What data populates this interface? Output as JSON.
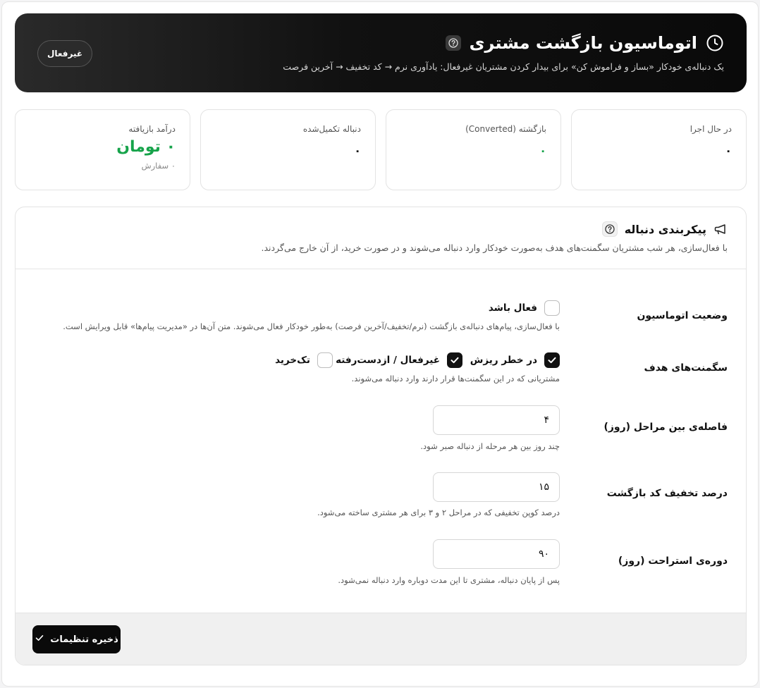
{
  "header": {
    "title": "اتوماسیون بازگشت مشتری",
    "subtitle": "یک دنباله‌ی خودکار «بساز و فراموش کن» برای بیدار کردن مشتریان غیرفعال: یادآوری نرم → کد تخفیف → آخرین فرصت",
    "status_button": "غیرفعال",
    "icon": "clock-icon",
    "help_icon": "help-icon"
  },
  "stats": [
    {
      "label": "در حال اجرا",
      "value": "۰"
    },
    {
      "label": "بازگشته (Converted)",
      "value": "۰",
      "color": "#16a34a"
    },
    {
      "label": "دنباله تکمیل‌شده",
      "value": "۰"
    },
    {
      "label": "درآمد بازیافته",
      "value": "۰ تومان",
      "sub": "۰ سفارش",
      "color": "#16a34a"
    }
  ],
  "config": {
    "title": "پیکربندی دنباله",
    "description": "با فعال‌سازی، هر شب مشتریان سگمنت‌های هدف به‌صورت خودکار وارد دنباله می‌شوند و در صورت خرید، از آن خارج می‌گردند.",
    "status": {
      "label": "وضعیت اتوماسیون",
      "checkbox_label": "فعال باشد",
      "checked": false,
      "helper": "با فعال‌سازی، پیام‌های دنباله‌ی بازگشت (نرم/تخفیف/آخرین فرصت) به‌طور خودکار فعال می‌شوند. متن آن‌ها در «مدیریت پیام‌ها» قابل ویرایش است."
    },
    "segments": {
      "label": "سگمنت‌های هدف",
      "options": [
        {
          "label": "در خطر ریزش",
          "checked": true
        },
        {
          "label": "غیرفعال / ازدست‌رفته",
          "checked": true
        },
        {
          "label": "تک‌خرید",
          "checked": false
        }
      ],
      "helper": "مشتریانی که در این سگمنت‌ها قرار دارند وارد دنباله می‌شوند."
    },
    "interval": {
      "label": "فاصله‌ی بین مراحل (روز)",
      "value": "۴",
      "helper": "چند روز بین هر مرحله از دنباله صبر شود."
    },
    "discount": {
      "label": "درصد تخفیف کد بازگشت",
      "value": "۱۵",
      "helper": "درصد کوپن تخفیفی که در مراحل ۲ و ۳ برای هر مشتری ساخته می‌شود."
    },
    "cooldown": {
      "label": "دوره‌ی استراحت (روز)",
      "value": "۹۰",
      "helper": "پس از پایان دنباله، مشتری تا این مدت دوباره وارد دنباله نمی‌شود."
    },
    "save_button": "ذخیره تنظیمات"
  },
  "colors": {
    "accent": "#16a34a",
    "dark": "#0a0a0a"
  }
}
